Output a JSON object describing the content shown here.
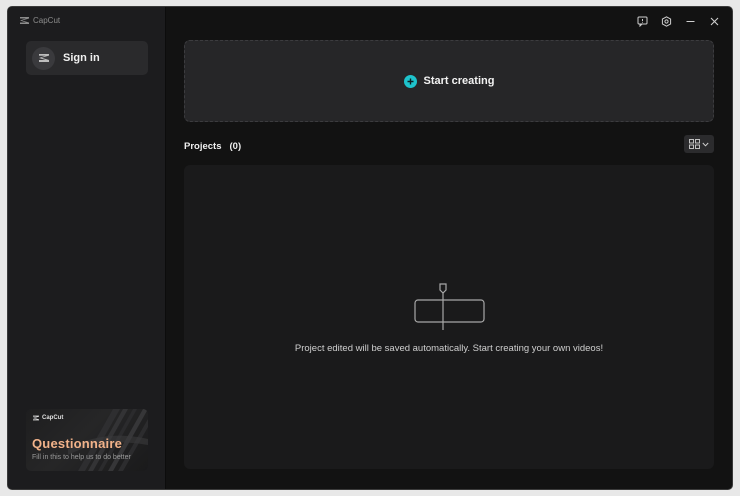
{
  "app": {
    "title": "CapCut"
  },
  "sidebar": {
    "signin_label": "Sign in",
    "questionnaire": {
      "brand": "CapCut",
      "title": "Questionnaire",
      "subtitle": "Fill in this to help us to do better"
    }
  },
  "main": {
    "start_label": "Start creating",
    "projects_label": "Projects",
    "projects_count": "(0)",
    "empty_message": "Project edited will be saved automatically. Start creating your own videos!"
  },
  "colors": {
    "accent": "#1ec3cc",
    "questionnaire_title": "#f2b38a"
  },
  "icons": {
    "titlebar": [
      "feedback-icon",
      "settings-icon",
      "minimize-icon",
      "close-icon"
    ],
    "view_toggle": "grid-view-icon"
  }
}
